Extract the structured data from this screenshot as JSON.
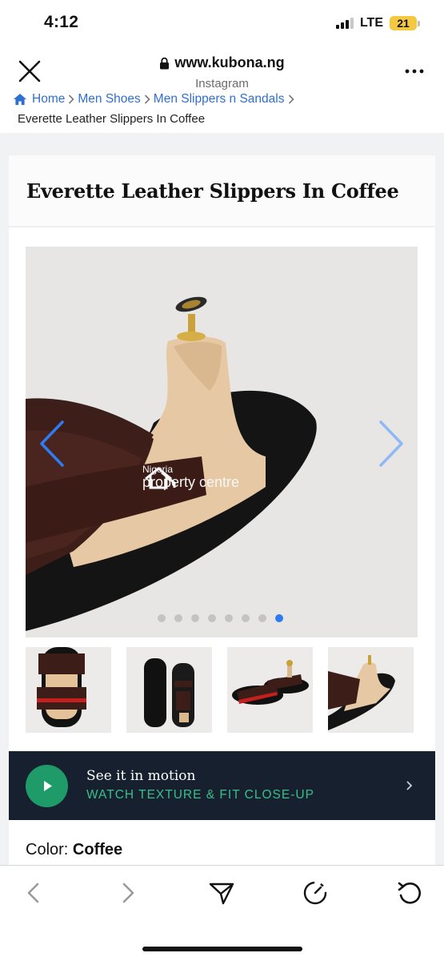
{
  "status_bar": {
    "time": "4:12",
    "network": "LTE",
    "battery": "21",
    "battery_color": "#f5c842"
  },
  "browser": {
    "url": "www.kubona.ng",
    "source": "Instagram",
    "close_icon": "close-icon",
    "more_icon": "more-icon"
  },
  "breadcrumb": {
    "items": [
      "Home",
      "Men Shoes",
      "Men Slippers n Sandals"
    ],
    "current": "Everette Leather Slippers In Coffee",
    "link_color": "#2f6fd1"
  },
  "product": {
    "title": "Everette Leather Slippers In Coffee",
    "carousel": {
      "total_slides": 8,
      "active_slide": 8
    },
    "watermark": {
      "small": "Nigeria",
      "big": "property centre"
    },
    "thumbnails": [
      {
        "name": "front-view"
      },
      {
        "name": "sole-view"
      },
      {
        "name": "pair-view"
      },
      {
        "name": "side-view"
      }
    ]
  },
  "motion_banner": {
    "title": "See it in motion",
    "subtitle": "WATCH TEXTURE & FIT CLOSE-UP",
    "accent_color": "#1f9b6a",
    "background_color": "#16202f"
  },
  "color_selector": {
    "label": "Color:",
    "value": "Coffee"
  },
  "toolbar": {
    "icons": [
      "back-icon",
      "forward-icon",
      "share-icon",
      "speed-icon",
      "reload-icon"
    ]
  }
}
